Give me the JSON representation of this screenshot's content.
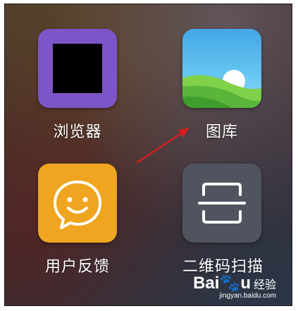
{
  "apps": [
    {
      "label": "浏览器",
      "icon": "browser-icon"
    },
    {
      "label": "图库",
      "icon": "gallery-icon"
    },
    {
      "label": "用户反馈",
      "icon": "smiley-chat-icon"
    },
    {
      "label": "二维码扫描",
      "icon": "qr-scan-icon"
    }
  ],
  "watermark": {
    "brand_left": "Bai",
    "brand_right": "u",
    "brand_cn": "经验",
    "url": "jingyan.baidu.com"
  },
  "colors": {
    "browser": "#7c55c9",
    "feedback": "#efa51f",
    "scan": "#50545f",
    "arrow": "#d41e1e"
  }
}
